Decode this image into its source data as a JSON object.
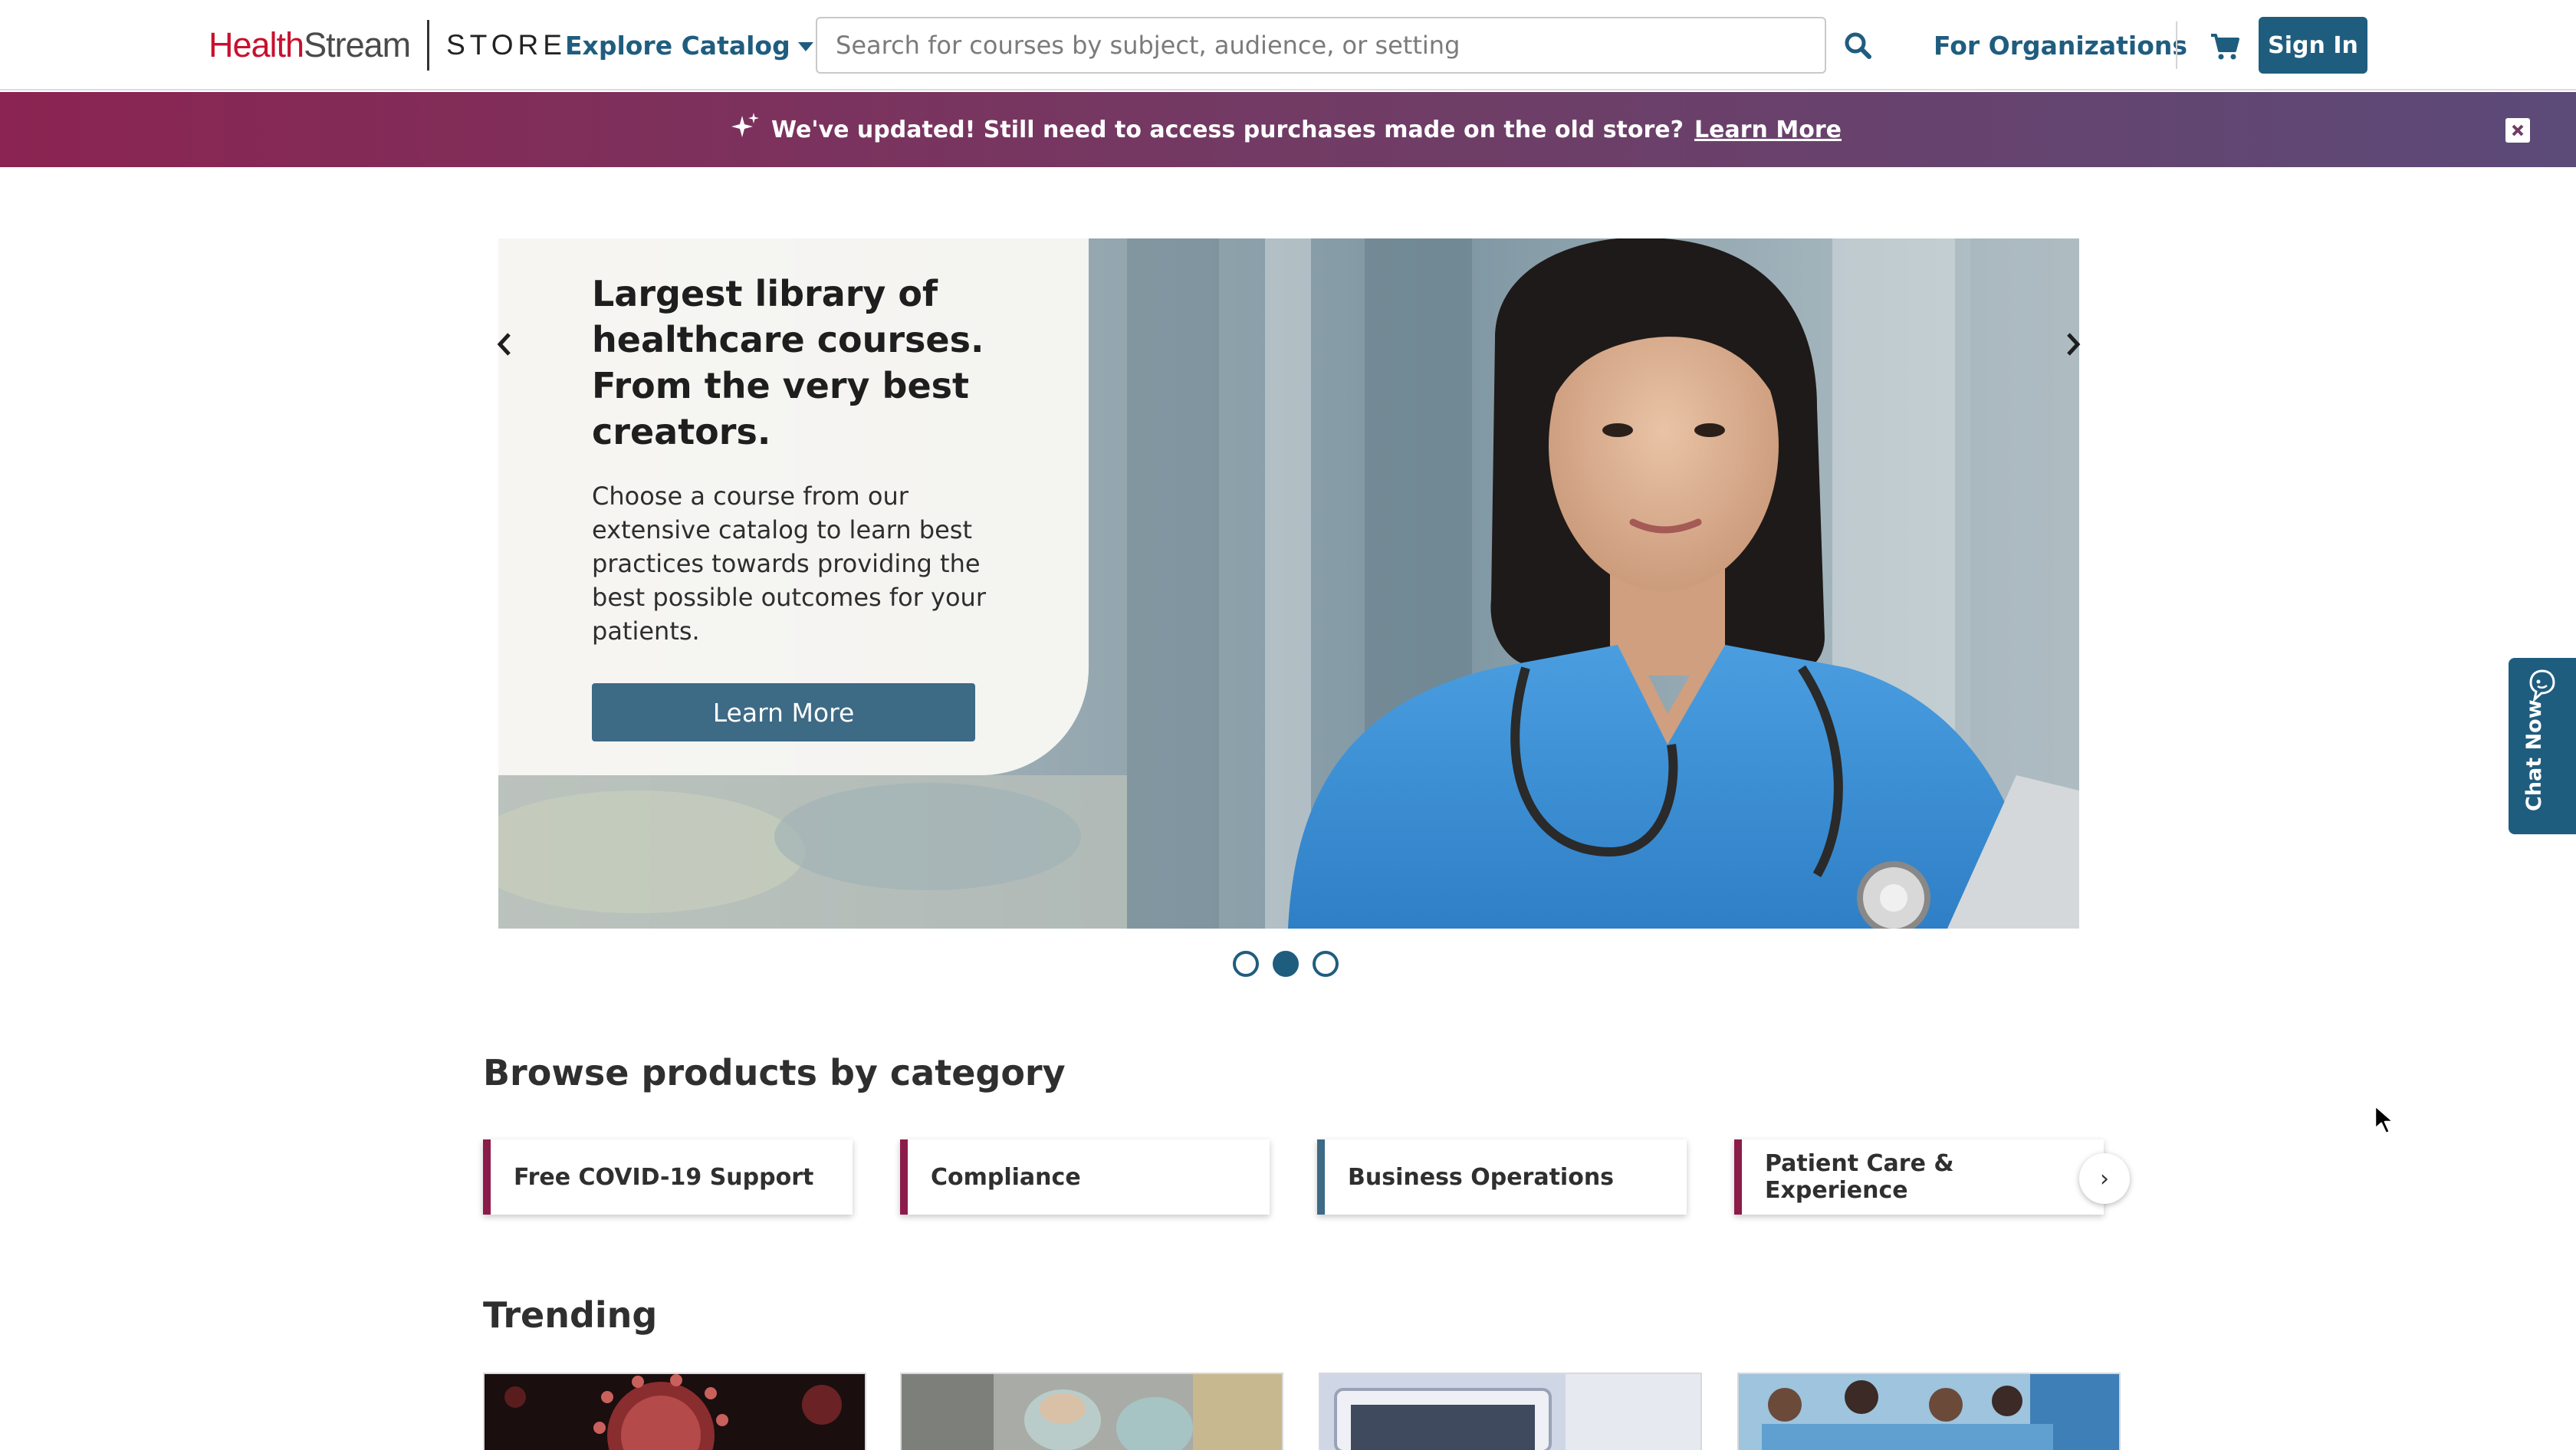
{
  "header": {
    "logo_health": "Health",
    "logo_stream": "Stream",
    "logo_store": "STORE",
    "explore_label": "Explore Catalog",
    "search_placeholder": "Search for courses by subject, audience, or setting",
    "for_organizations": "For Organizations",
    "sign_in": "Sign In",
    "icons": [
      "chevron-down-icon",
      "search-icon",
      "cart-icon"
    ]
  },
  "banner": {
    "message": "We've updated! Still need to access purchases made on the old store?",
    "link": "Learn More",
    "icons": [
      "sparkle-icon",
      "close-icon"
    ],
    "colors": [
      "#8b2452",
      "#5c4a78"
    ]
  },
  "hero": {
    "title": "Largest library of healthcare courses. From the very best creators.",
    "text": "Choose a course from our extensive catalog to learn best practices towards providing the best possible outcomes for your patients.",
    "button": "Learn More",
    "slide_index": 2,
    "slide_count": 3,
    "icons": [
      "chevron-left-icon",
      "chevron-right-icon"
    ]
  },
  "categories": {
    "title": "Browse products by category",
    "items": [
      {
        "label": "Free COVID-19 Support",
        "accent": "#8b1c4a"
      },
      {
        "label": "Compliance",
        "accent": "#8b1c4a"
      },
      {
        "label": "Business Operations",
        "accent": "#3d6a85"
      },
      {
        "label": "Patient Care & Experience",
        "accent": "#8b1c4a"
      }
    ],
    "next_icon": "chevron-right-icon"
  },
  "trending": {
    "title": "Trending"
  },
  "chat": {
    "label": "Chat Now",
    "icon": "chat-bubble-icon"
  },
  "colors": {
    "brand": "#1f5d7f",
    "logo_red": "#c8102e"
  }
}
